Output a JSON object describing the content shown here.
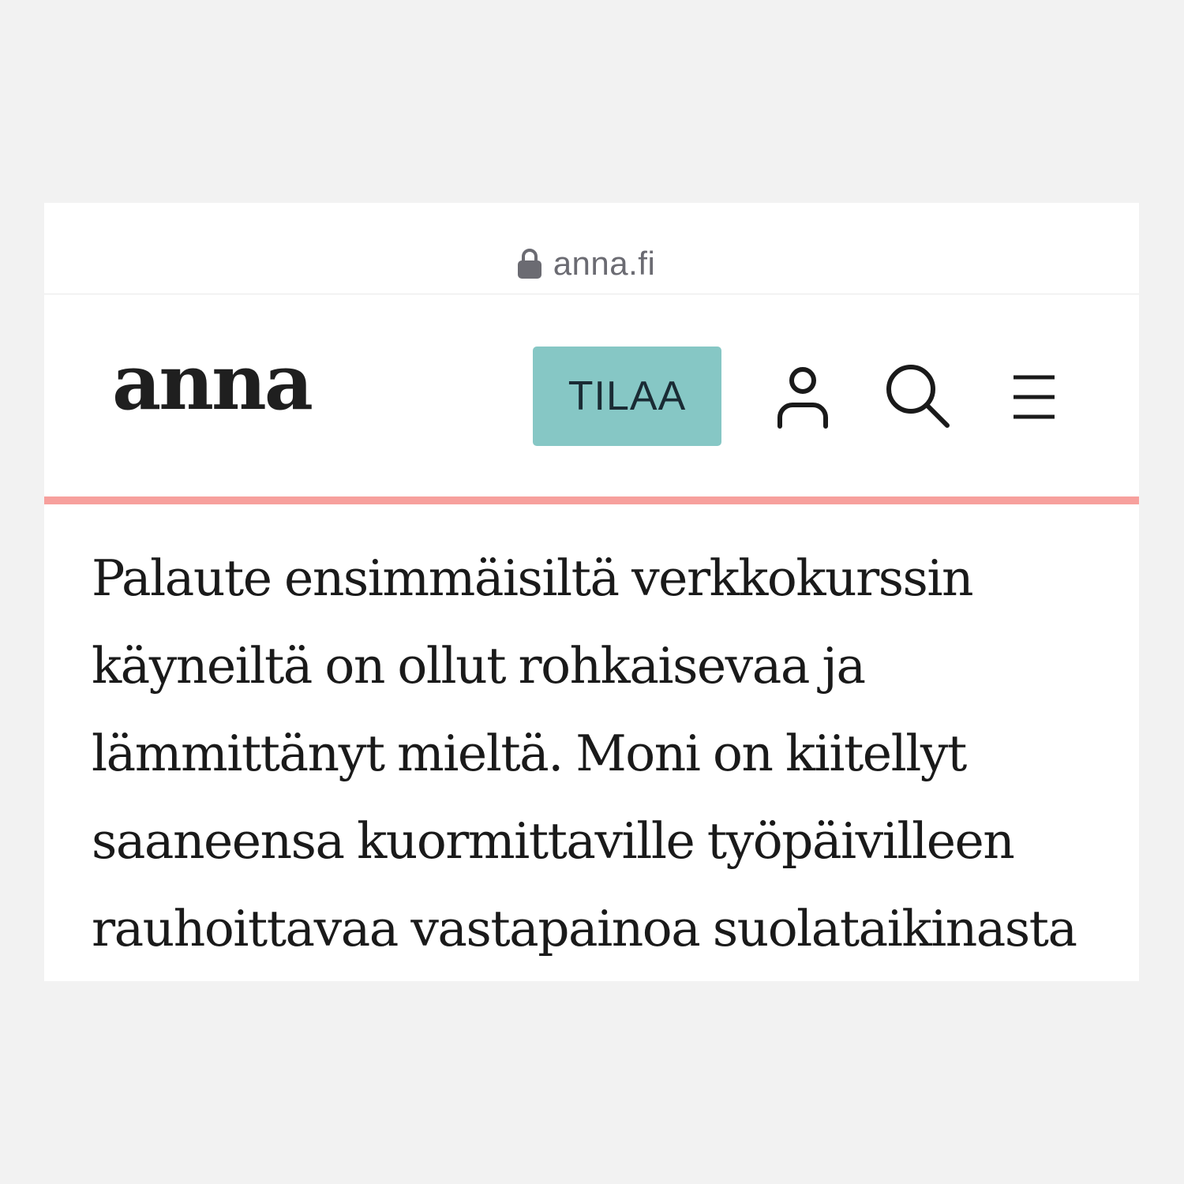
{
  "browser": {
    "url": "anna.fi",
    "lock_icon": "lock-icon"
  },
  "header": {
    "logo": "anna",
    "subscribe_label": "TILAA",
    "subscribe_color": "#86c7c5",
    "user_icon": "user-icon",
    "search_icon": "search-icon",
    "menu_icon": "hamburger-menu-icon",
    "accent_color": "#f7a09d"
  },
  "article": {
    "text": "Palaute ensimmäisiltä verkkokurssin käyneiltä on ollut rohkaisevaa ja lämmittänyt mieltä. Moni on kiitellyt saaneensa kuormittaville työpäivilleen rauhoittavaa vastapainoa suolataikinasta"
  }
}
